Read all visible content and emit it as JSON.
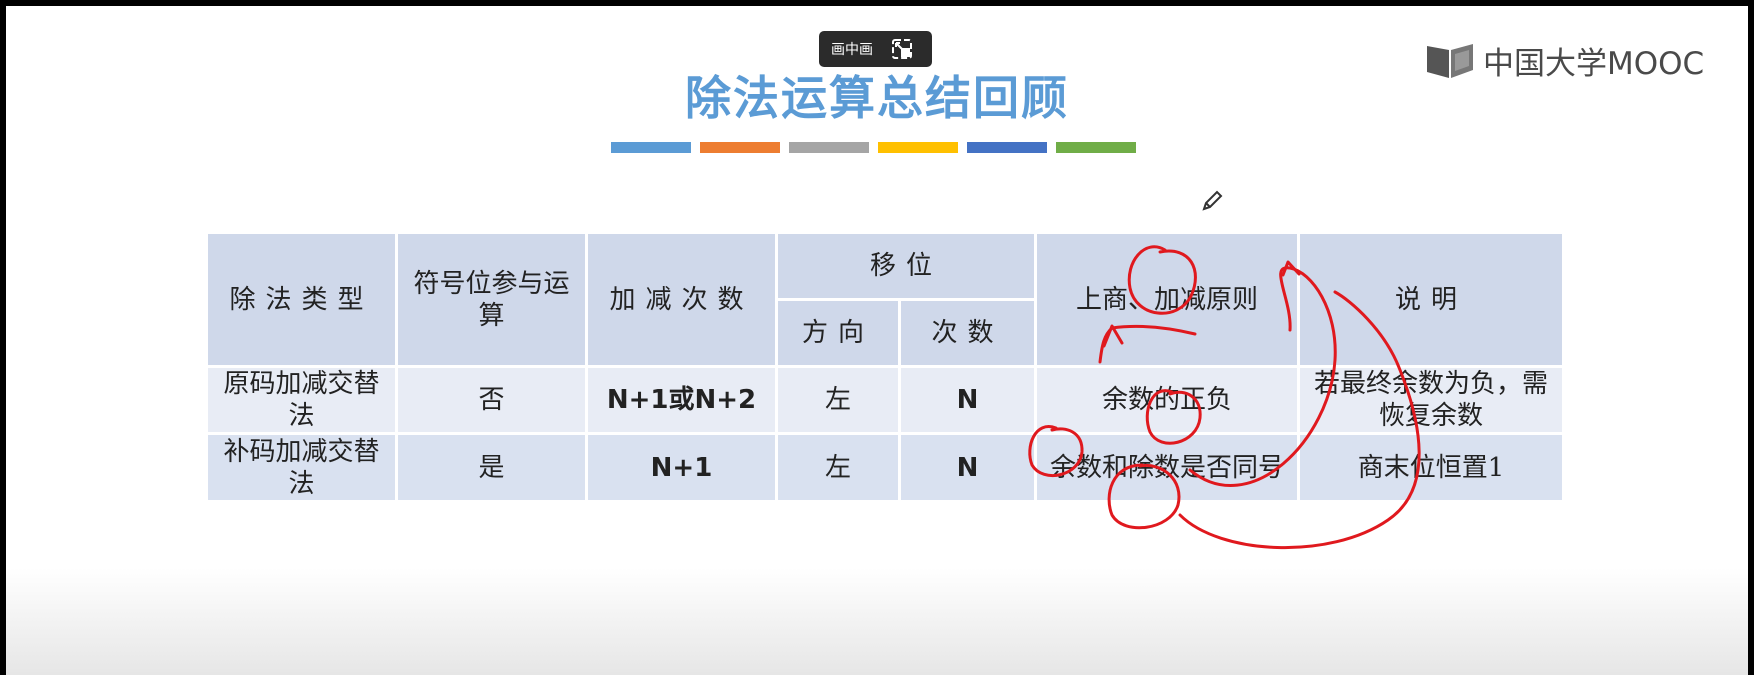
{
  "pip_button": {
    "label": "画中画",
    "icon": "pip-restore-icon"
  },
  "logo": {
    "text": "中国大学MOOC",
    "icon": "mooc-book-icon"
  },
  "title": "除法运算总结回顾",
  "stripe_colors": [
    "#5b9bd5",
    "#ed7d31",
    "#a5a5a5",
    "#ffc000",
    "#4472c4",
    "#70ad47"
  ],
  "table": {
    "headers": {
      "type": "除法类型",
      "sign_bit": "符号位参与运算",
      "add_sub_count": "加减次数",
      "shift": "移位",
      "direction": "方向",
      "shift_count": "次数",
      "rule": "上商、加减原则",
      "note": "说明"
    },
    "rows": [
      {
        "type": "原码加减交替法",
        "sign_bit": "否",
        "add_sub_count": "N+1或N+2",
        "direction": "左",
        "shift_count": "N",
        "rule": "余数的正负",
        "note": "若最终余数为负，需恢复余数"
      },
      {
        "type": "补码加减交替法",
        "sign_bit": "是",
        "add_sub_count": "N+1",
        "direction": "左",
        "shift_count": "N",
        "rule": "余数和除数是否同号",
        "note": "商末位恒置1"
      }
    ]
  },
  "annotation": {
    "ink_color": "#e0191e",
    "tool_icon": "pencil-icon"
  }
}
